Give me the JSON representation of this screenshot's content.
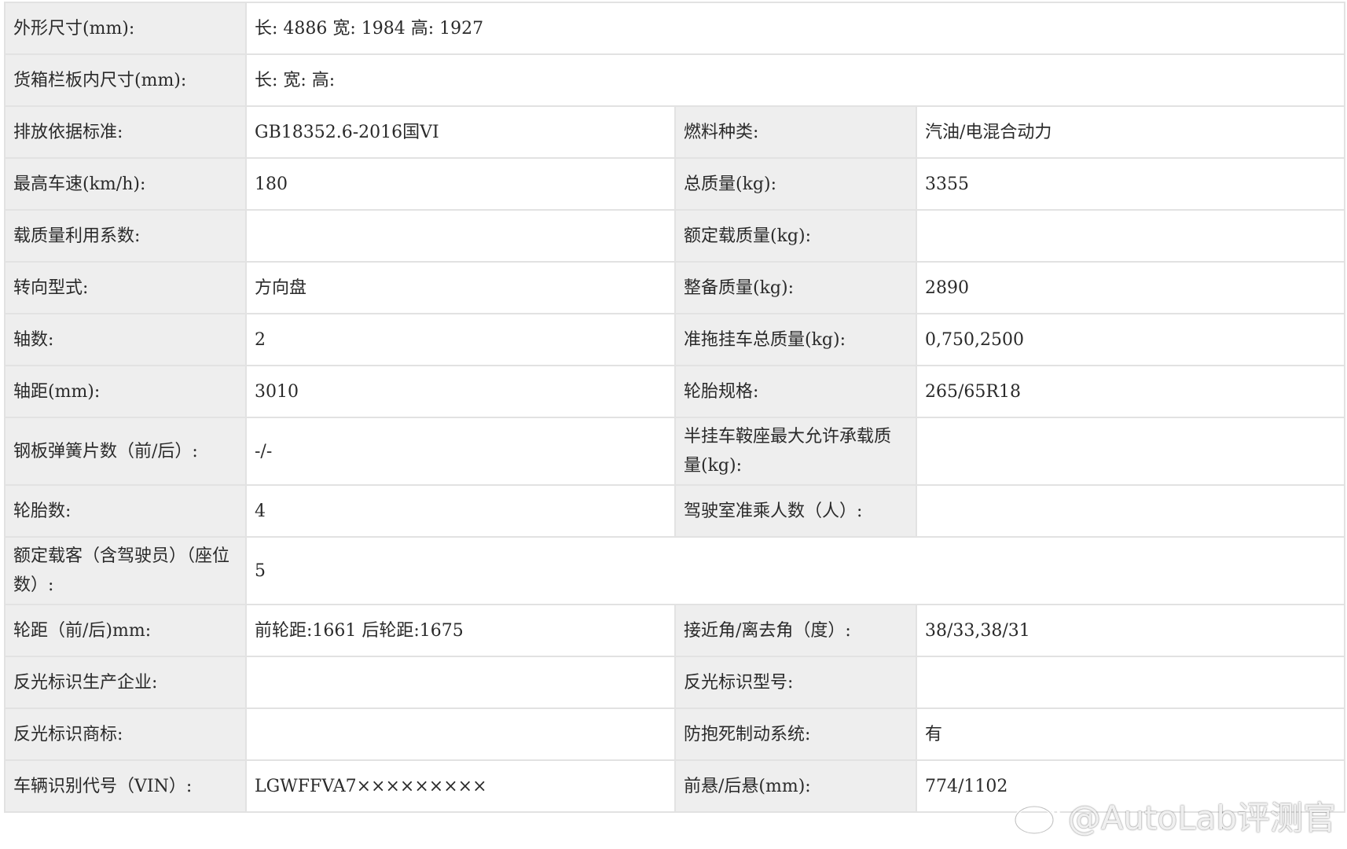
{
  "table": {
    "dims_label": "外形尺寸(mm):",
    "dims_value": "长: 4886 宽: 1984 高: 1927",
    "cargo_label": "货箱栏板内尺寸(mm):",
    "cargo_value": "长:   宽:   高:",
    "emission_label": "排放依据标准:",
    "emission_value": "GB18352.6-2016国VI",
    "fuel_label": "燃料种类:",
    "fuel_value": "汽油/电混合动力",
    "speed_label": "最高车速(km/h):",
    "speed_value": "180",
    "gross_label": "总质量(kg):",
    "gross_value": "3355",
    "load_util_label": "载质量利用系数:",
    "load_util_value": "",
    "rated_load_label": "额定载质量(kg):",
    "rated_load_value": "",
    "steering_label": "转向型式:",
    "steering_value": "方向盘",
    "curb_label": "整备质量(kg):",
    "curb_value": "2890",
    "axles_label": "轴数:",
    "axles_value": "2",
    "trailer_label": "准拖挂车总质量(kg):",
    "trailer_value": "0,750,2500",
    "wheelbase_label": "轴距(mm):",
    "wheelbase_value": "3010",
    "tire_spec_label": "轮胎规格:",
    "tire_spec_value": "265/65R18",
    "spring_label": "钢板弹簧片数（前/后）:",
    "spring_value": "-/-",
    "saddle_label": "半挂车鞍座最大允许承载质量(kg):",
    "saddle_value": "",
    "tires_label": "轮胎数:",
    "tires_value": "4",
    "cab_label": "驾驶室准乘人数（人）:",
    "cab_value": "",
    "passengers_label": "额定载客（含驾驶员）（座位数）:",
    "passengers_value": "5",
    "track_label": "轮距（前/后)mm:",
    "track_value": "前轮距:1661 后轮距:1675",
    "angle_label": "接近角/离去角（度）:",
    "angle_value": "38/33,38/31",
    "reflect_maker_label": "反光标识生产企业:",
    "reflect_maker_value": "",
    "reflect_model_label": "反光标识型号:",
    "reflect_model_value": "",
    "reflect_brand_label": "反光标识商标:",
    "reflect_brand_value": "",
    "abs_label": "防抱死制动系统:",
    "abs_value": "有",
    "vin_label": "车辆识别代号（VIN）:",
    "vin_value": "LGWFFVA7×××××××××",
    "overhang_label": "前悬/后悬(mm):",
    "overhang_value": "774/1102"
  },
  "watermark": {
    "text": "@AutoLab评测官",
    "icon": "weibo-icon"
  }
}
